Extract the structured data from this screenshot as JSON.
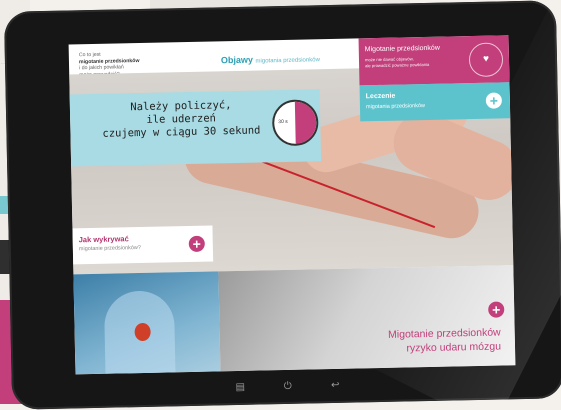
{
  "faq": {
    "line1": "Co to jest",
    "line2": "migotanie przedsionków",
    "line3": "i do jakich powikłań",
    "line4": "może prowadzić?"
  },
  "objawy": {
    "title": "Objawy",
    "subtitle": "migotania przedsionków"
  },
  "migotanie_panel": {
    "title": "Migotanie przedsionków",
    "sub1": "może nie dawać objawów,",
    "sub2": "ale prowadzić poważne powikłania"
  },
  "leczenie": {
    "title": "Leczenie",
    "subtitle": "migotania przedsionków"
  },
  "callout": {
    "line1": "Należy policzyć,",
    "line2": "ile uderzeń",
    "line3": "czujemy w ciągu 30 sekund",
    "timer_label": "30 s"
  },
  "jak": {
    "title": "Jak wykrywać",
    "subtitle": "migotanie przedsionków?"
  },
  "family_tile": {
    "line1": "Migotanie przedsionków",
    "line2": "ryzyko udaru mózgu"
  },
  "icons": {
    "plus": "+",
    "heart": "♥",
    "menu": "▤",
    "power": "⏻",
    "back": "↩"
  },
  "colors": {
    "pink": "#c23f7b",
    "teal": "#5cc3cd",
    "light_teal": "#a8dbe3"
  }
}
